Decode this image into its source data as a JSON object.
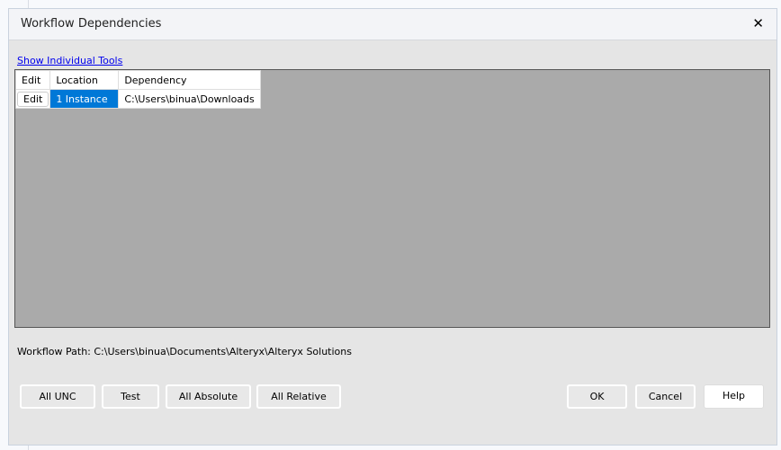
{
  "dialog": {
    "title": "Workflow Dependencies",
    "close": "✕"
  },
  "link": "Show Individual Tools",
  "table": {
    "headers": [
      "Edit",
      "Location",
      "Dependency"
    ],
    "rows": [
      {
        "edit": "Edit",
        "location": "1 Instance",
        "dependency": "C:\\Users\\binua\\Downloads"
      }
    ]
  },
  "workflow_path": "Workflow Path: C:\\Users\\binua\\Documents\\Alteryx\\Alteryx Solutions",
  "buttons": {
    "all_unc": "All UNC",
    "test": "Test",
    "all_absolute": "All Absolute",
    "all_relative": "All Relative",
    "ok": "OK",
    "cancel": "Cancel",
    "help": "Help"
  }
}
